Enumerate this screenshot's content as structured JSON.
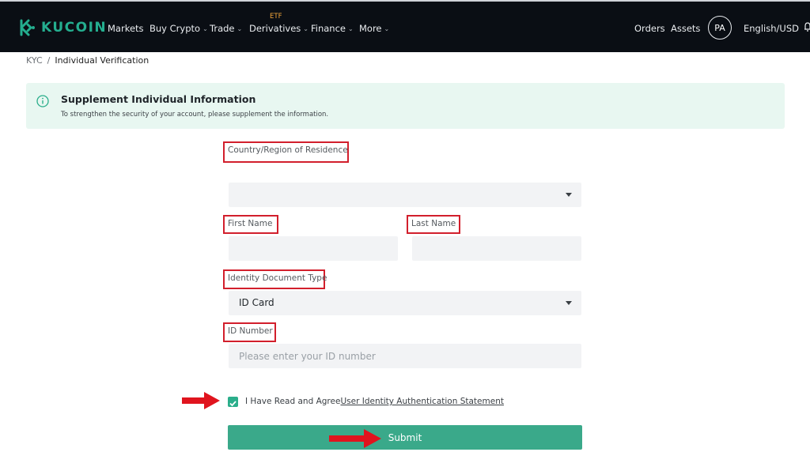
{
  "header": {
    "brand": "KUCOIN",
    "nav": [
      {
        "label": "Markets",
        "has_menu": false
      },
      {
        "label": "Buy Crypto",
        "has_menu": true
      },
      {
        "label": "Trade",
        "has_menu": true
      },
      {
        "label": "Derivatives",
        "has_menu": true
      },
      {
        "label": "Finance",
        "has_menu": true
      },
      {
        "label": "More",
        "has_menu": true
      }
    ],
    "etf_badge": "ETF",
    "orders": "Orders",
    "assets": "Assets",
    "avatar_initials": "PA",
    "language": "English/USD"
  },
  "breadcrumb": {
    "root": "KYC",
    "separator": "/",
    "current": "Individual Verification"
  },
  "notice": {
    "title": "Supplement Individual Information",
    "description": "To strengthen the security of your account, please supplement the information."
  },
  "form": {
    "country_label": "Country/Region of Residence",
    "country_value": "",
    "first_name_label": "First Name",
    "first_name_value": "",
    "last_name_label": "Last Name",
    "last_name_value": "",
    "doc_type_label": "Identity Document Type",
    "doc_type_value": "ID Card",
    "id_number_label": "ID Number",
    "id_number_placeholder": "Please enter your ID number",
    "agree_text": "I Have Read and Agree",
    "agree_link": "User Identity Authentication Statement",
    "agree_checked": true,
    "submit_label": "Submit"
  },
  "colors": {
    "brand": "#24ae8f",
    "submit": "#3aa98a",
    "annotation_red": "#d21f2c",
    "notice_bg": "#e8f7f1"
  }
}
